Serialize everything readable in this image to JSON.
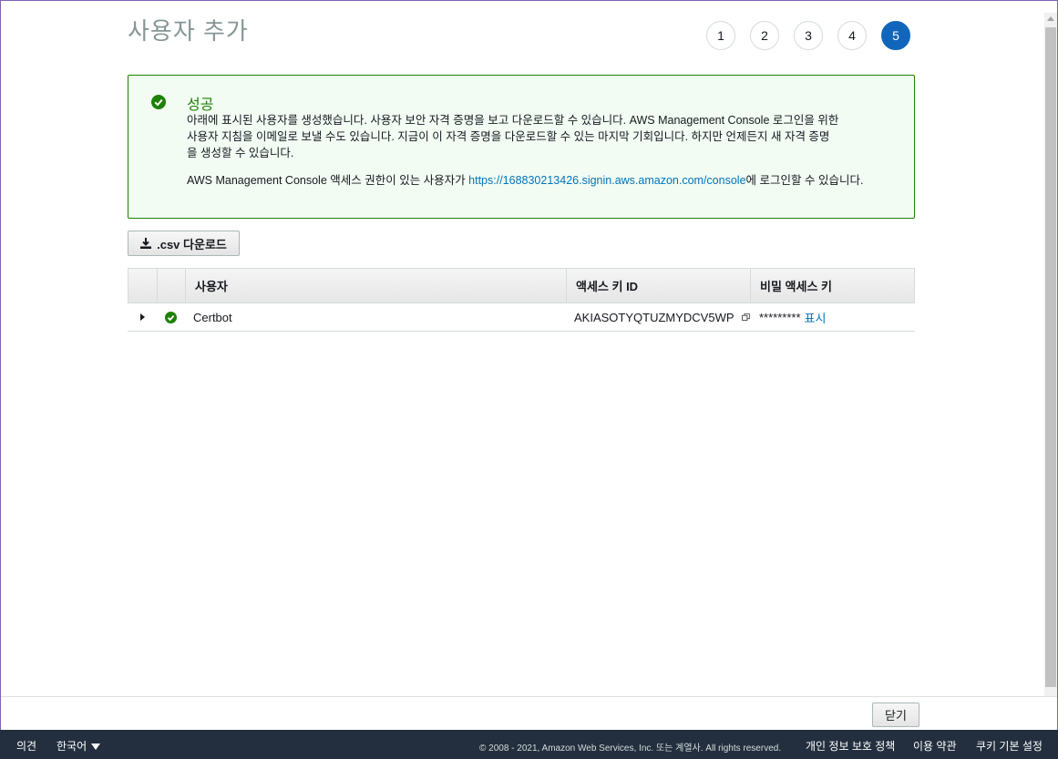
{
  "page_title": "사용자 추가",
  "steps": [
    "1",
    "2",
    "3",
    "4",
    "5"
  ],
  "active_step": "5",
  "alert": {
    "title": "성공",
    "line1": "아래에 표시된 사용자를 생성했습니다. 사용자 보안 자격 증명을 보고 다운로드할 수 있습니다. AWS Management Console 로그인을 위한",
    "line2": "사용자 지침을 이메일로 보낼 수도 있습니다. 지금이 이 자격 증명을 다운로드할 수 있는 마지막 기회입니다. 하지만 언제든지 새 자격 증명",
    "line3": "을 생성할 수 있습니다.",
    "console_prefix": "AWS Management Console 액세스 권한이 있는 사용자가 ",
    "console_url": "https://168830213426.signin.aws.amazon.com/console",
    "console_suffix": "에 로그인할 수 있습니다.",
    "status_color": "#1d8102"
  },
  "csv_button": ".csv 다운로드",
  "table": {
    "headers": [
      "사용자",
      "액세스 키 ID",
      "비밀 액세스 키"
    ],
    "rows": [
      {
        "user": "Certbot",
        "access_key_id": "AKIASOTYQTUZMYDCV5WP",
        "secret_masked": "*********",
        "show_label": "표시"
      }
    ]
  },
  "close_button": "닫기",
  "footer": {
    "feedback": "의견",
    "language": "한국어",
    "copyright": "© 2008 - 2021, Amazon Web Services, Inc. 또는 계열사. All rights reserved.",
    "privacy": "개인 정보 보호 정책",
    "terms": "이용 약관",
    "cookies": "쿠키 기본 설정"
  },
  "colors": {
    "accent": "#1166bb",
    "footer_bg": "#232f3e",
    "link": "#0073bb"
  }
}
